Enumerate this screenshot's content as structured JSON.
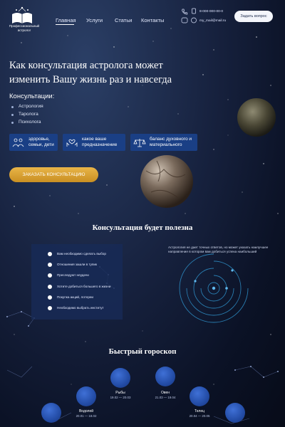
{
  "header": {
    "logo_text": "Профессиональный астролог",
    "nav": [
      {
        "label": "Главная",
        "active": true
      },
      {
        "label": "Услуги",
        "active": false
      },
      {
        "label": "Статьи",
        "active": false
      },
      {
        "label": "Контакты",
        "active": false
      }
    ],
    "phone": "8-000-000-00-0",
    "email": "my_mail@mail.ru",
    "ask_button": "Задать вопрос"
  },
  "hero": {
    "title": "Как консультация астролога может изменить Вашу жизнь раз и навсегда",
    "consultations_label": "Консультации:",
    "consultations": [
      "Астрология",
      "Таролога",
      "Психолога"
    ],
    "features": [
      {
        "icon": "people-icon",
        "text": "здоровье, семьи, дети"
      },
      {
        "icon": "heart-hands-icon",
        "text": "какое ваше предназначение"
      },
      {
        "icon": "balance-icon",
        "text": "баланс духовного и материального"
      }
    ],
    "cta": "ЗАКАЗАТЬ КОНСУЛЬТАЦИЮ"
  },
  "useful": {
    "title": "Консультация будет полезна",
    "items": [
      "Вам необходимо сделать выбор",
      "Отношения зашли в тупик",
      "Преследуют неудачи",
      "Хотите добиться большего в жизни",
      "Покупка акций, лотереи",
      "Необходимо выбрать институт"
    ],
    "note": "Астрология не дает точных ответов, но может указать наилучшее направление в котором вам добиться успеха наибольший"
  },
  "horoscope": {
    "title": "Быстрый гороскоп",
    "signs": [
      {
        "name": "Рыбы",
        "dates": "19.02 — 20.03"
      },
      {
        "name": "Овен",
        "dates": "21.03 — 19.04"
      },
      {
        "name": "Водолей",
        "dates": "20.01 — 18.02"
      },
      {
        "name": "Телец",
        "dates": "20.04 — 20.05"
      }
    ]
  },
  "colors": {
    "background": "#111a33",
    "feature_box": "#1a3f85",
    "cta_gold": "#d9a23a",
    "sign_blue": "#2a55b5"
  }
}
